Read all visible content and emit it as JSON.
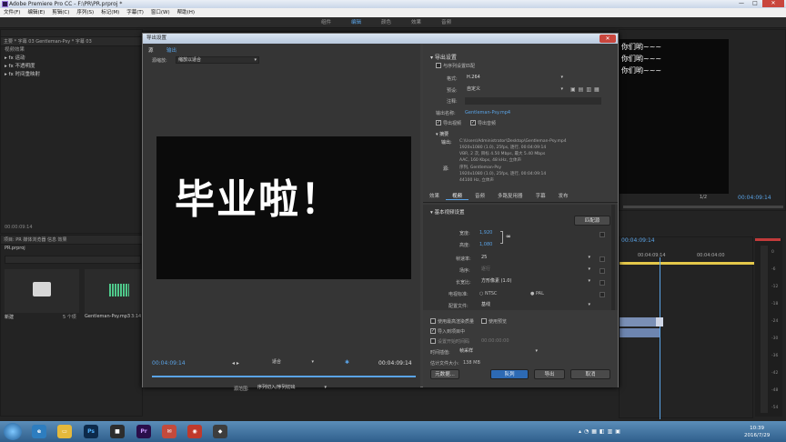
{
  "app": {
    "title": "Adobe Premiere Pro CC - F:\\PR\\PR.prproj *"
  },
  "menu": [
    "文件(F)",
    "编辑(E)",
    "剪辑(C)",
    "序列(S)",
    "标记(M)",
    "字幕(T)",
    "窗口(W)",
    "帮助(H)"
  ],
  "workspace_tabs": [
    "组件",
    "编辑",
    "颜色",
    "效果",
    "音频"
  ],
  "effects_panel": {
    "tabs": "主要 * 字幕 03  Gentleman-Psy * 字幕 03",
    "section": "视频效果",
    "items": [
      "运动",
      "不透明度",
      "时间重映射"
    ],
    "timecode": "00:00:09:14"
  },
  "project_panel": {
    "tabs": "项目: PR  媒体浏览器  信息  效果",
    "file": "PR.prproj",
    "bin_name": "新建",
    "bin_count": "5 个项",
    "clip_name": "Gentleman-Psy.mp3",
    "clip_duration": "3:14"
  },
  "program_monitor": {
    "subtitles": [
      "你们哟~~~",
      "你们哟~~~",
      "你们哟~~~"
    ],
    "zoom": "1/2",
    "timecode": "00:04:09:14"
  },
  "timeline": {
    "timecode": "00:04:09:14",
    "times": [
      "00:04:09:14",
      "00:04:04:00"
    ],
    "meter_labels": [
      "0",
      "-6",
      "-12",
      "-18",
      "-24",
      "-30",
      "-36",
      "-42",
      "-48",
      "-54"
    ]
  },
  "dialog": {
    "title": "导出设置",
    "source_tabs": [
      "源",
      "输出"
    ],
    "scale_label": "源缩放:",
    "scale_value": "缩放以适合",
    "preview_text": "毕业啦！",
    "time_left": "00:04:09:14",
    "time_right": "00:04:09:14",
    "fit_value": "适合",
    "range_label": "源范围:",
    "range_value": "序列切入/序列切出",
    "export_settings": {
      "header": "导出设置",
      "match_seq": "与序列设置匹配",
      "format_label": "格式:",
      "format_value": "H.264",
      "preset_label": "预设:",
      "preset_value": "自定义",
      "comment_label": "注释:",
      "output_label": "输出名称:",
      "output_value": "Gentleman-Psy.mp4",
      "export_video": "导出视频",
      "export_audio": "导出音频"
    },
    "summary": {
      "header": "摘要",
      "output_label": "输出:",
      "output_lines": [
        "C:\\Users\\Administrator\\Desktop\\Gentleman-Psy.mp4",
        "1920x1080 (1.0), 25fps, 逐行, 00:04:09:14",
        "VBR, 2 次, 目标 4.50 Mbps, 最大 5.40 Mbps",
        "AAC, 160 Kbps, 48 kHz, 立体声"
      ],
      "source_label": "源:",
      "source_lines": [
        "序列, Gentleman-Psy",
        "1920x1080 (1.0), 25fps, 逐行, 00:04:09:14",
        "44100 Hz, 立体声"
      ]
    },
    "tabs": [
      "效果",
      "视频",
      "音频",
      "多路复用器",
      "字幕",
      "发布"
    ],
    "video": {
      "header": "基本视频设置",
      "match_btn": "匹配源",
      "width_label": "宽度:",
      "width_value": "1,920",
      "height_label": "高度:",
      "height_value": "1,080",
      "fps_label": "帧速率:",
      "fps_value": "25",
      "field_label": "场序:",
      "field_value": "逐行",
      "aspect_label": "长宽比:",
      "aspect_value": "方形像素 (1.0)",
      "tv_label": "电视标准:",
      "ntsc": "NTSC",
      "pal": "PAL",
      "profile_label": "配置文件:",
      "profile_value": "基线"
    },
    "options": {
      "max_render": "使用最高渲染质量",
      "use_preview": "使用预览",
      "import_project": "导入到项目中",
      "set_start_tc": "设置开始时间码",
      "start_tc": "00:00:00:00",
      "interp_label": "时间插值:",
      "interp_value": "帧采样",
      "est_label": "估计文件大小:",
      "est_value": "138 MB"
    },
    "buttons": {
      "metadata": "元数据...",
      "queue": "队列",
      "export": "导出",
      "cancel": "取消"
    }
  },
  "taskbar": {
    "time": "10:39",
    "date": "2016/7/29"
  }
}
